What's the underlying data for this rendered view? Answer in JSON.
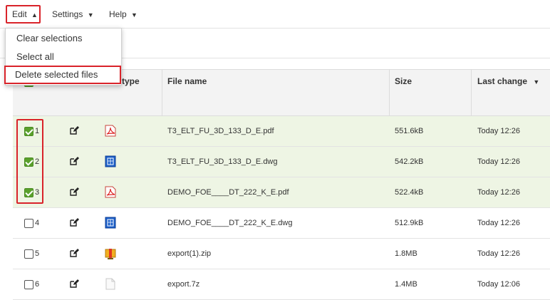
{
  "menubar": {
    "edit": "Edit",
    "edit_caret": "▲",
    "settings": "Settings",
    "settings_caret": "▼",
    "help": "Help",
    "help_caret": "▼"
  },
  "dropdown": {
    "items": [
      "Clear selections",
      "Select all",
      "Delete selected files"
    ]
  },
  "table": {
    "headers": {
      "type": "type",
      "filename": "File name",
      "size": "Size",
      "last_change": "Last change",
      "sort_indicator": "▼"
    },
    "rows": [
      {
        "num": "1",
        "checked": true,
        "type_icon": "pdf-icon",
        "name": "T3_ELT_FU_3D_133_D_E.pdf",
        "size": "551.6kB",
        "changed": "Today 12:26"
      },
      {
        "num": "2",
        "checked": true,
        "type_icon": "dwg-icon",
        "name": "T3_ELT_FU_3D_133_D_E.dwg",
        "size": "542.2kB",
        "changed": "Today 12:26"
      },
      {
        "num": "3",
        "checked": true,
        "type_icon": "pdf-icon",
        "name": "DEMO_FOE____DT_222_K_E.pdf",
        "size": "522.4kB",
        "changed": "Today 12:26"
      },
      {
        "num": "4",
        "checked": false,
        "type_icon": "dwg-icon",
        "name": "DEMO_FOE____DT_222_K_E.dwg",
        "size": "512.9kB",
        "changed": "Today 12:26"
      },
      {
        "num": "5",
        "checked": false,
        "type_icon": "zip-icon",
        "name": "export(1).zip",
        "size": "1.8MB",
        "changed": "Today 12:26"
      },
      {
        "num": "6",
        "checked": false,
        "type_icon": "file-icon",
        "name": "export.7z",
        "size": "1.4MB",
        "changed": "Today 12:06"
      }
    ]
  },
  "colors": {
    "highlight": "#d9232a",
    "selected_row": "#eef5e4",
    "checkbox": "#5aa02c"
  }
}
